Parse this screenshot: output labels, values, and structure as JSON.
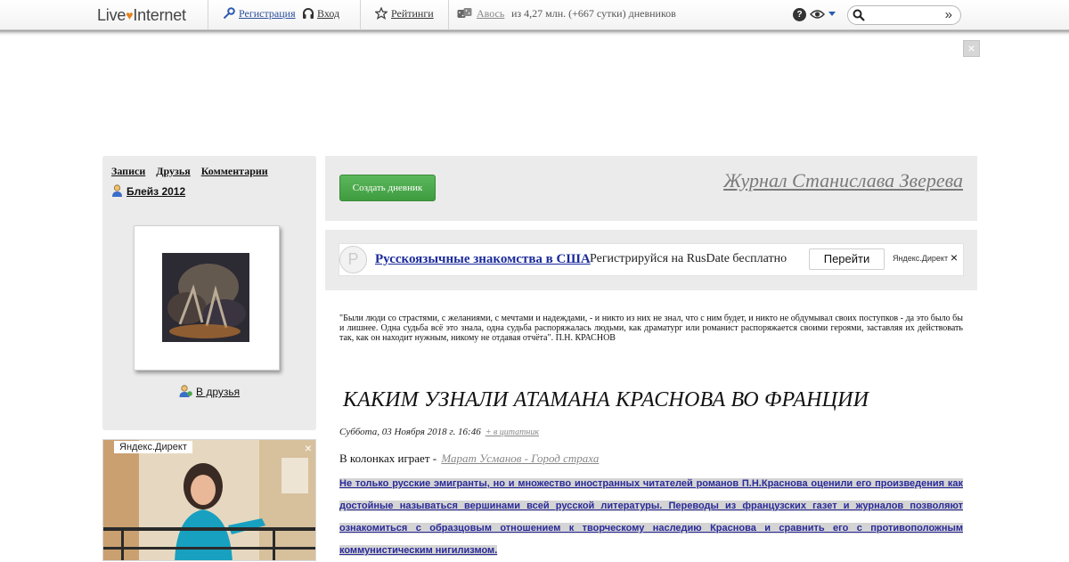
{
  "topbar": {
    "logo_main": "Live",
    "logo_tail": "Internet",
    "register": "Регистрация",
    "login": "Вход",
    "ratings": "Рейтинги",
    "avos": "Авось",
    "stats": "из 4,27 млн. (+667 сутки) дневников",
    "search_placeholder": "",
    "search_go": "»"
  },
  "top_ad": {
    "close": "×"
  },
  "sidebar": {
    "tabs": [
      "Записи",
      "Друзья",
      "Комментарии"
    ],
    "username": "Блейз 2012",
    "add_friend": "В друзья",
    "ad_label": "Яндекс.Директ",
    "ad_close": "×"
  },
  "header": {
    "create_button": "Создать дневник",
    "journal_title": "Журнал Станислава Зверева"
  },
  "direct_ad": {
    "logo_letter": "Р",
    "title": "Русскоязычные знакомства в США",
    "text": "Регистрируйся на RusDate бесплатно",
    "button": "Перейти",
    "label": "Яндекс.Директ",
    "close": "×"
  },
  "post": {
    "epigraph": "\"Были люди со страстями, с желаниями, с мечтами и надеждами, - и никто из них не знал, что с ним будет, и никто не обдумывал своих поступков - да это было бы и лишнее. Одна судьба всё это знала, одна судьба распоряжалась людьми, как драматург или романист распоряжается своими героями, заставляя их действовать так, как он находит нужным, никому не отдавая отчёта\".  П.Н. КРАСНОВ",
    "title": "КАКИМ УЗНАЛИ АТАМАНА КРАСНОВА ВО ФРАНЦИИ",
    "date": "Суббота, 03 Ноября 2018 г. 16:46",
    "quote_link": "+ в цитатник",
    "now_playing_label": "В колонках играет -",
    "now_playing_track": "Марат Усманов - Город страха",
    "body": "Не только русские эмигранты, но и множество иностранных читателей романов П.Н.Краснова оценили его произведения как достойные называться вершинами всей русской литературы. Переводы из французских газет и журналов позволяют ознакомиться с образцовым отношением к творческому наследию Краснова и сравнить его с противоположным коммунистическим нигилизмом."
  }
}
